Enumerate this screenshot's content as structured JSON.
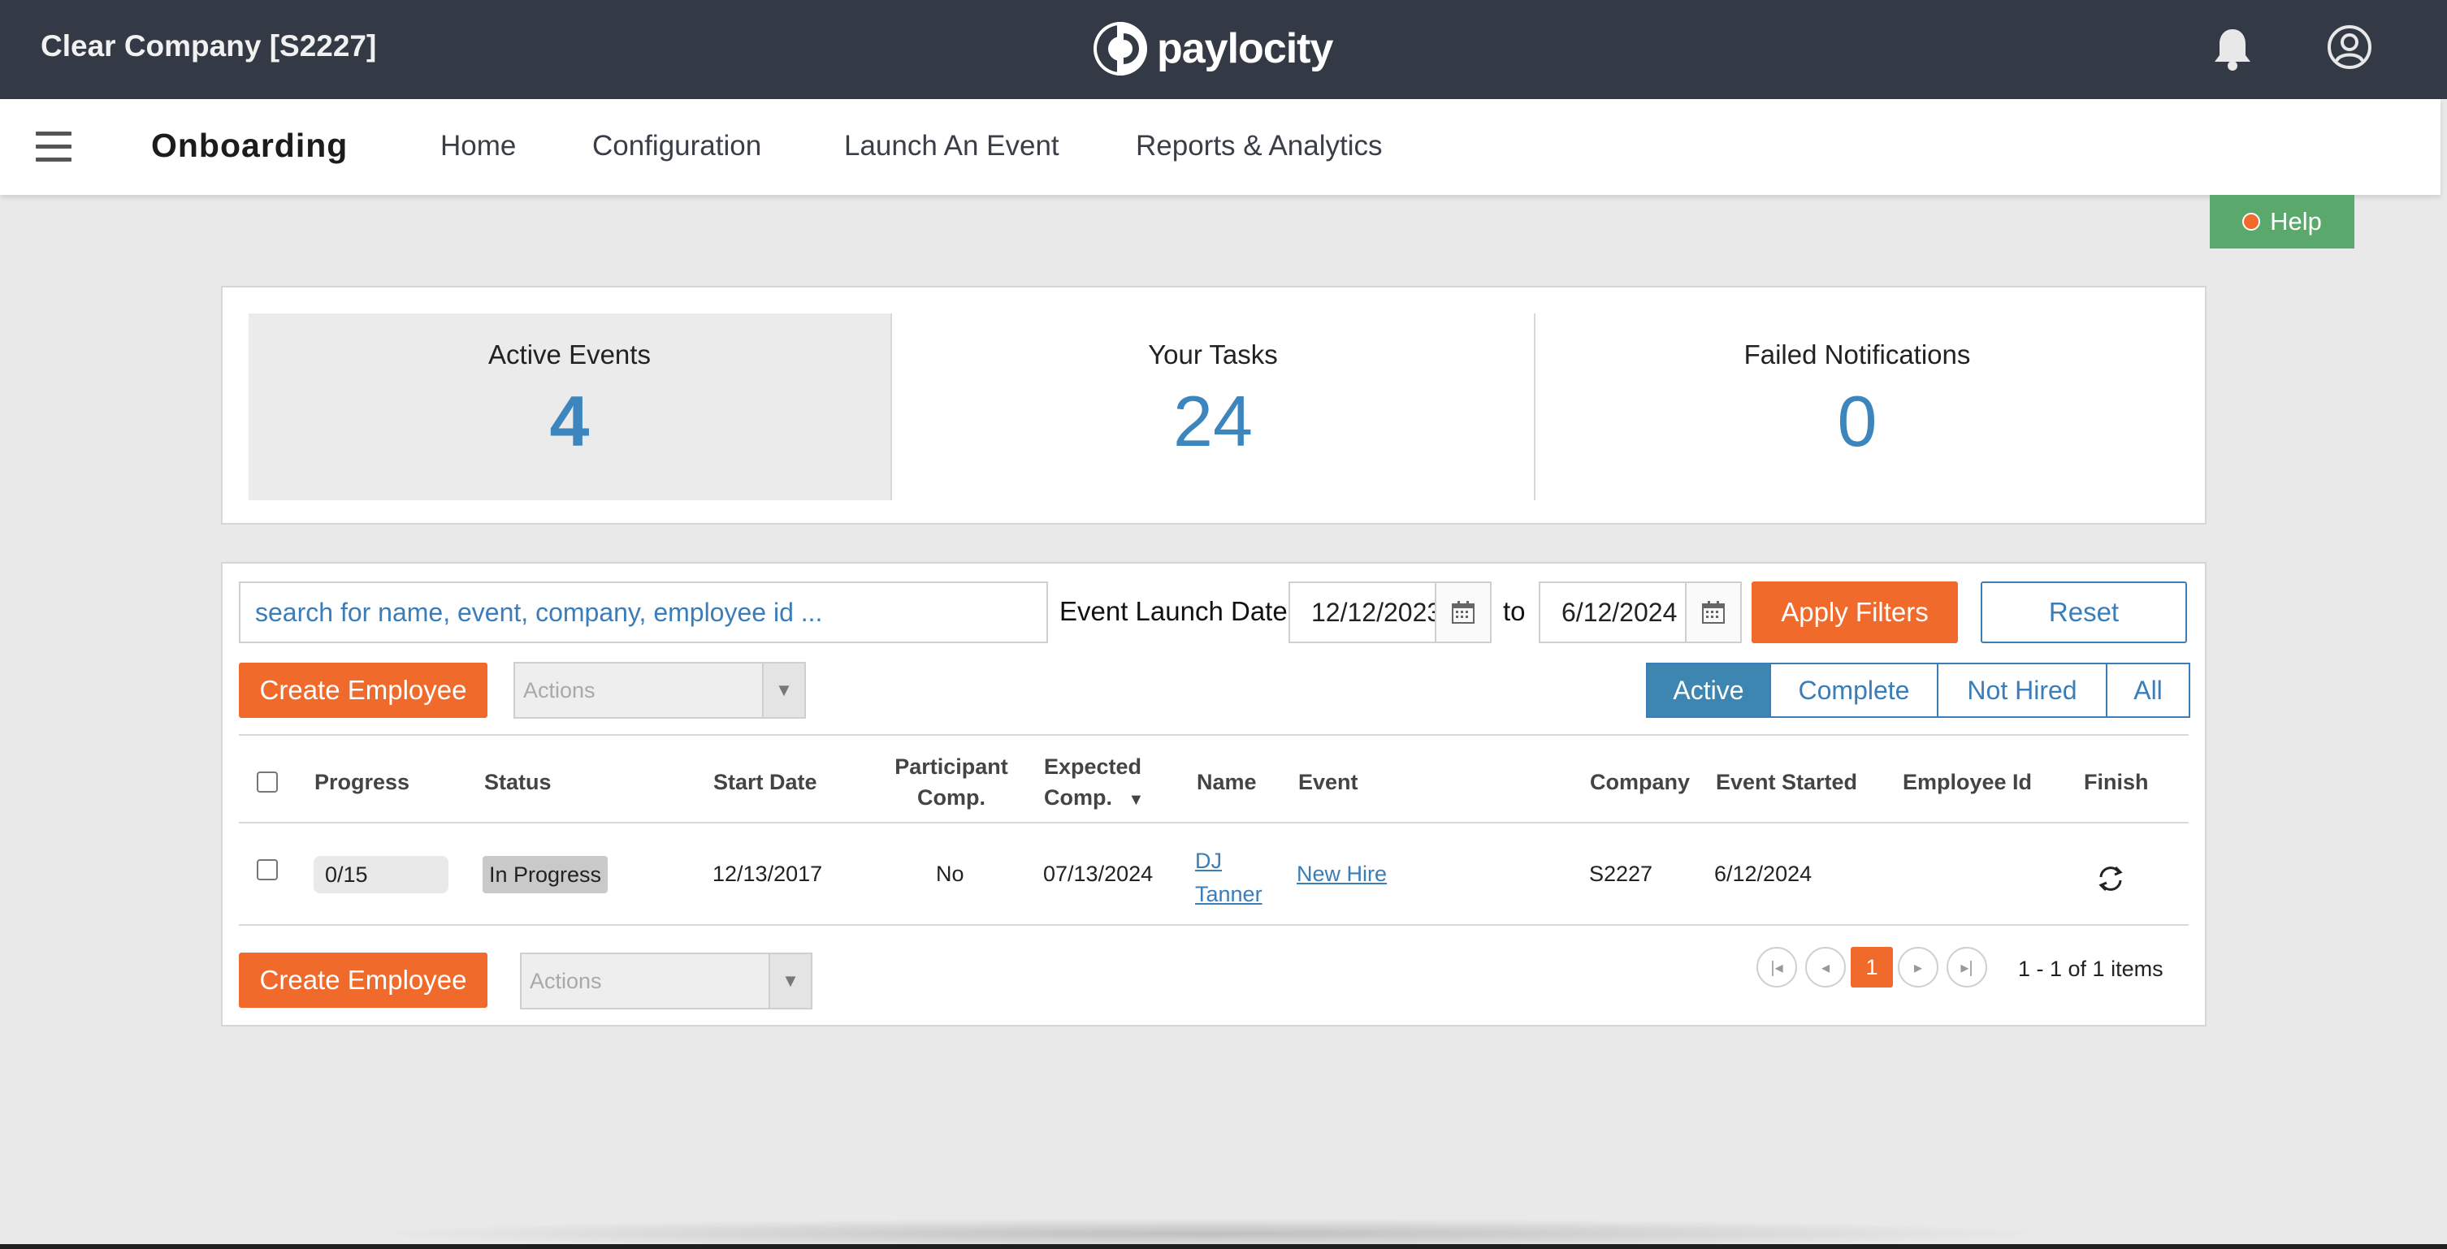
{
  "header": {
    "company": "Clear Company [S2227]",
    "logo_text": "paylocity",
    "icons": [
      "bell-icon",
      "user-circle-icon"
    ]
  },
  "nav": {
    "app_title": "Onboarding",
    "links": [
      "Home",
      "Configuration",
      "Launch An Event",
      "Reports & Analytics"
    ]
  },
  "help": {
    "label": "Help"
  },
  "summary": {
    "active_events": {
      "label": "Active Events",
      "value": "4"
    },
    "your_tasks": {
      "label": "Your Tasks",
      "value": "24"
    },
    "failed_notifications": {
      "label": "Failed Notifications",
      "value": "0"
    }
  },
  "filters": {
    "search_placeholder": "search for name, event, company, employee id ...",
    "date_label": "Event Launch Date:",
    "date_from": "12/12/2023",
    "to_label": "to",
    "date_to": "6/12/2024",
    "apply_label": "Apply Filters",
    "reset_label": "Reset"
  },
  "toolbar": {
    "create_label": "Create Employee",
    "actions_placeholder": "Actions",
    "status_tabs": [
      "Active",
      "Complete",
      "Not Hired",
      "All"
    ],
    "active_tab": "Active"
  },
  "table": {
    "headers": {
      "progress": "Progress",
      "status": "Status",
      "start_date": "Start Date",
      "participant_comp_1": "Participant",
      "participant_comp_2": "Comp.",
      "expected_comp_1": "Expected",
      "expected_comp_2": "Comp.",
      "sort_indicator": "▼",
      "name": "Name",
      "event": "Event",
      "company": "Company",
      "event_started": "Event Started",
      "employee_id": "Employee Id",
      "finish": "Finish"
    },
    "rows": [
      {
        "progress": "0/15",
        "status": "In Progress",
        "start_date": "12/13/2017",
        "participant_comp": "No",
        "expected_comp": "07/13/2024",
        "name_first": "DJ",
        "name_last": "Tanner",
        "event": "New Hire",
        "company": "S2227",
        "event_started": "6/12/2024",
        "employee_id": ""
      }
    ]
  },
  "pagination": {
    "current_page": "1",
    "info": "1 - 1 of 1 items"
  },
  "colors": {
    "header_bg": "#343a45",
    "accent_orange": "#f06a2c",
    "accent_blue": "#3a7db8",
    "help_green": "#5aa86b"
  }
}
